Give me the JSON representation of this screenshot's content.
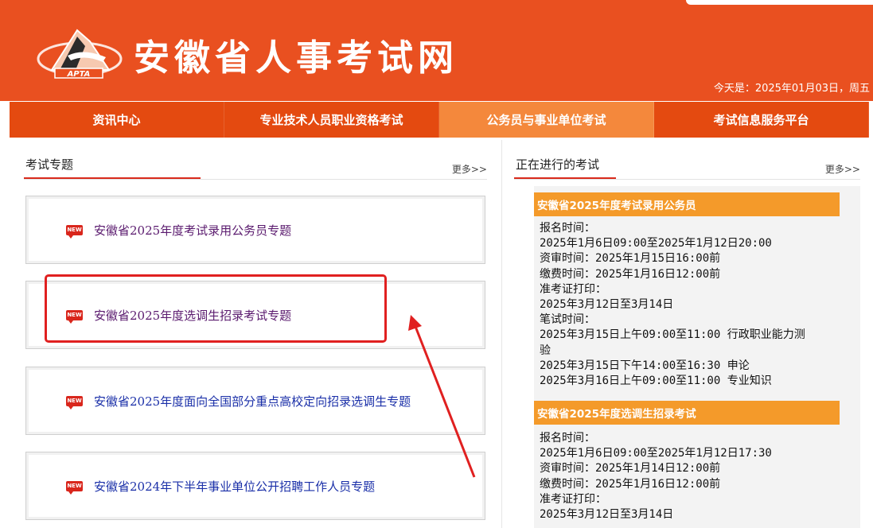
{
  "header": {
    "site_title": "安徽省人事考试网",
    "logo_text": "APTA",
    "date_text": "今天是：2025年01月03日，周五",
    "brand_color": "#e95020"
  },
  "nav": {
    "items": [
      {
        "label": "资讯中心"
      },
      {
        "label": "专业技术人员职业资格考试"
      },
      {
        "label": "公务员与事业单位考试",
        "active": true
      },
      {
        "label": "考试信息服务平台"
      }
    ]
  },
  "topics_section": {
    "title": "考试专题",
    "more": "更多>>",
    "items": [
      {
        "badge": "NEW",
        "text": "安徽省2025年度考试录用公务员专题",
        "color": "#5a1a6e"
      },
      {
        "badge": "NEW",
        "text": "安徽省2025年度选调生招录考试专题",
        "color": "#5a1a6e"
      },
      {
        "badge": "NEW",
        "text": "安徽省2025年度面向全国部分重点高校定向招录选调生专题",
        "color": "#1a2fa8"
      },
      {
        "badge": "NEW",
        "text": "安徽省2024年下半年事业单位公开招聘工作人员专题",
        "color": "#1a2fa8"
      }
    ]
  },
  "ongoing_section": {
    "title": "正在进行的考试",
    "more": "更多>>",
    "exams": [
      {
        "title": "安徽省2025年度考试录用公务员",
        "lines": [
          "报名时间：",
          "2025年1月6日09:00至2025年1月12日20:00",
          "资审时间：2025年1月15日16:00前",
          "缴费时间：2025年1月16日12:00前",
          "准考证打印：",
          "2025年3月12日至3月14日",
          "笔试时间：",
          "2025年3月15日上午09:00至11:00 行政职业能力测",
          "验",
          "2025年3月15日下午14:00至16:30 申论",
          "2025年3月16日上午09:00至11:00 专业知识"
        ]
      },
      {
        "title": "安徽省2025年度选调生招录考试",
        "lines": [
          "报名时间：",
          "2025年1月6日09:00至2025年1月12日17:30",
          "资审时间：2025年1月14日12:00前",
          "缴费时间：2025年1月16日12:00前",
          "准考证打印：",
          "2025年3月12日至3月14日"
        ]
      }
    ]
  }
}
